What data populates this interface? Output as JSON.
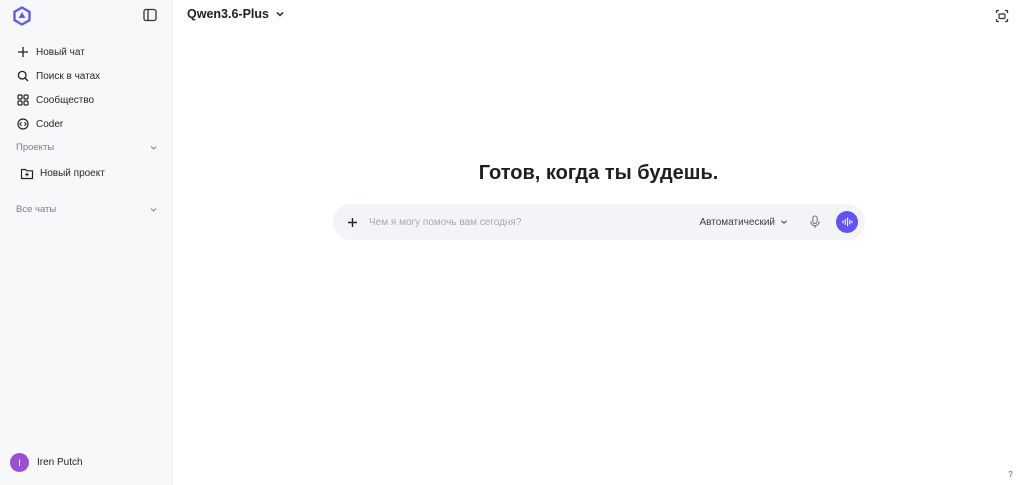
{
  "sidebar": {
    "nav": [
      {
        "label": "Новый чат",
        "icon": "plus-icon"
      },
      {
        "label": "Поиск в чатах",
        "icon": "search-icon"
      },
      {
        "label": "Сообщество",
        "icon": "grid-icon"
      },
      {
        "label": "Coder",
        "icon": "code-icon"
      }
    ],
    "projects_label": "Проекты",
    "new_project_label": "Новый проект",
    "all_chats_label": "Все чаты",
    "user": {
      "initial": "I",
      "name": "Iren Putch",
      "avatar_color": "#9b4fd6"
    }
  },
  "header": {
    "model": "Qwen3.6-Plus"
  },
  "main": {
    "headline": "Готов, когда ты будешь.",
    "input": {
      "placeholder": "Чем я могу помочь вам сегодня?",
      "value": ""
    },
    "mode_label": "Автоматический",
    "help": "?"
  },
  "colors": {
    "accent": "#6152f2",
    "logo": "#615ced",
    "sidebar_bg": "#f7f8fa",
    "input_bg": "#f3f4f7"
  }
}
